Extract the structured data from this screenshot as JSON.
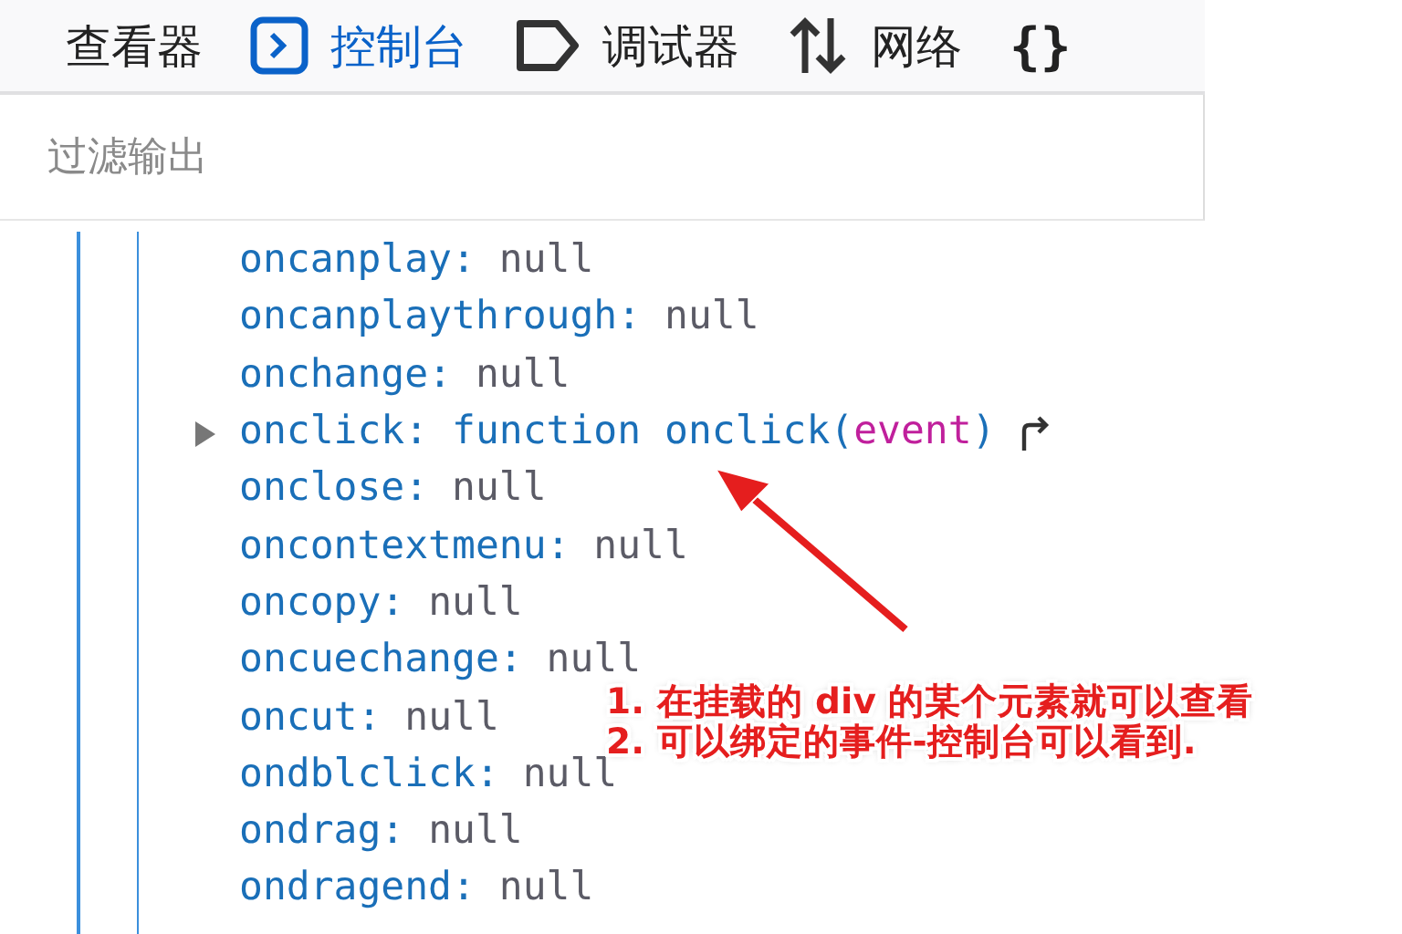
{
  "tabs": [
    {
      "kind": "inspector",
      "label": "查看器",
      "selected": false
    },
    {
      "kind": "console",
      "label": "控制台",
      "selected": true
    },
    {
      "kind": "debugger",
      "label": "调试器",
      "selected": false
    },
    {
      "kind": "network",
      "label": "网络",
      "selected": false
    },
    {
      "kind": "style",
      "label": "{}",
      "selected": false
    }
  ],
  "filter": {
    "placeholder": "过滤输出"
  },
  "properties": [
    {
      "kind": "null",
      "name": "oncanplay:",
      "value": "null"
    },
    {
      "kind": "null",
      "name": "oncanplaythrough:",
      "value": "null"
    },
    {
      "kind": "null",
      "name": "onchange:",
      "value": "null"
    },
    {
      "kind": "function",
      "name": "onclick:",
      "keyword": "function",
      "function_name": "onclick(",
      "params": "event",
      "close": ")",
      "expanded": false
    },
    {
      "kind": "null",
      "name": "onclose:",
      "value": "null"
    },
    {
      "kind": "null",
      "name": "oncontextmenu:",
      "value": "null"
    },
    {
      "kind": "null",
      "name": "oncopy:",
      "value": "null"
    },
    {
      "kind": "null",
      "name": "oncuechange:",
      "value": "null"
    },
    {
      "kind": "null",
      "name": "oncut:",
      "value": "null"
    },
    {
      "kind": "null",
      "name": "ondblclick:",
      "value": "null"
    },
    {
      "kind": "null",
      "name": "ondrag:",
      "value": "null"
    },
    {
      "kind": "null",
      "name": "ondragend:",
      "value": "null"
    }
  ],
  "annotation": {
    "lines": [
      "1. 在挂载的 div 的某个元素就可以查看",
      "2. 可以绑定的事件-控制台可以看到."
    ]
  }
}
